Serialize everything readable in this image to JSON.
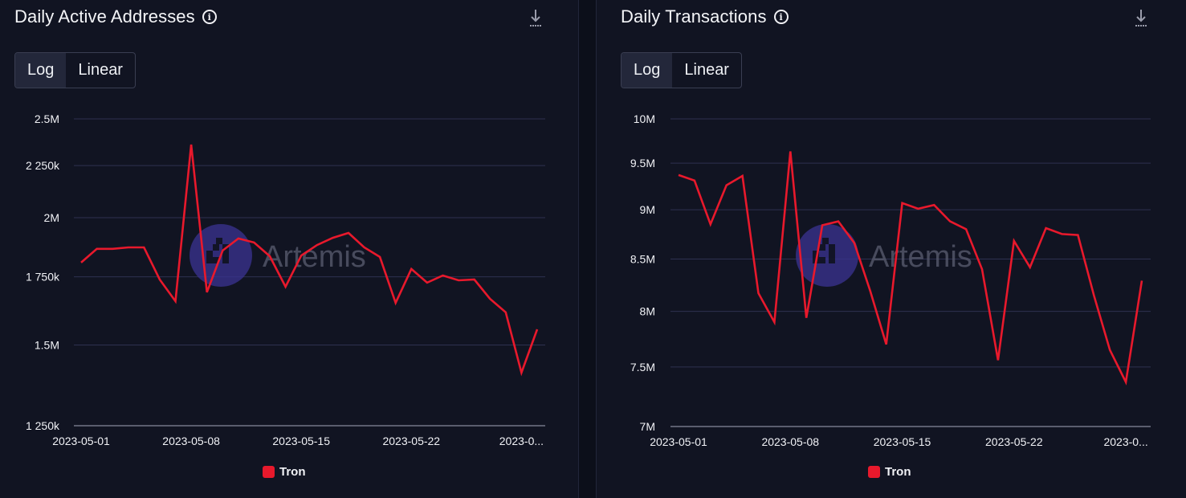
{
  "panels": [
    {
      "title": "Daily Active Addresses",
      "info_icon": "info-circle-icon",
      "download_icon": "download-icon",
      "scale_toggle": {
        "options": [
          "Log",
          "Linear"
        ],
        "selected": "Log"
      },
      "watermark": "Artemis",
      "legend": [
        {
          "label": "Tron",
          "color": "#e8192c"
        }
      ]
    },
    {
      "title": "Daily Transactions",
      "info_icon": "info-circle-icon",
      "download_icon": "download-icon",
      "scale_toggle": {
        "options": [
          "Log",
          "Linear"
        ],
        "selected": "Log"
      },
      "watermark": "Artemis",
      "legend": [
        {
          "label": "Tron",
          "color": "#e8192c"
        }
      ]
    }
  ],
  "chart_data": [
    {
      "type": "line",
      "title": "Daily Active Addresses",
      "xlabel": "",
      "ylabel": "",
      "yscale": "log",
      "ylim": [
        1250000,
        2500000
      ],
      "yticks": [
        {
          "value": 2500000,
          "label": "2.5M"
        },
        {
          "value": 2250000,
          "label": "2 250k"
        },
        {
          "value": 2000000,
          "label": "2M"
        },
        {
          "value": 1750000,
          "label": "1 750k"
        },
        {
          "value": 1500000,
          "label": "1.5M"
        },
        {
          "value": 1250000,
          "label": "1 250k"
        }
      ],
      "xticks": [
        {
          "index": 0,
          "label": "2023-05-01"
        },
        {
          "index": 7,
          "label": "2023-05-08"
        },
        {
          "index": 14,
          "label": "2023-05-15"
        },
        {
          "index": 21,
          "label": "2023-05-22"
        },
        {
          "index": 28,
          "label": "2023-0..."
        }
      ],
      "x_start": "2023-05-01",
      "x_end": "2023-05-30",
      "grid": true,
      "legend_position": "bottom",
      "series": [
        {
          "name": "Tron",
          "color": "#e8192c",
          "values": [
            1807000,
            1864000,
            1864000,
            1870000,
            1870000,
            1739000,
            1656000,
            2359000,
            1690000,
            1857000,
            1908000,
            1891000,
            1833000,
            1711000,
            1836000,
            1880000,
            1911000,
            1932000,
            1870000,
            1830000,
            1650000,
            1781000,
            1727000,
            1755000,
            1736000,
            1739000,
            1665000,
            1615000,
            1409000,
            1554000
          ]
        }
      ]
    },
    {
      "type": "line",
      "title": "Daily Transactions",
      "xlabel": "",
      "ylabel": "",
      "yscale": "log",
      "ylim": [
        7000000,
        10000000
      ],
      "yticks": [
        {
          "value": 10000000,
          "label": "10M"
        },
        {
          "value": 9500000,
          "label": "9.5M"
        },
        {
          "value": 9000000,
          "label": "9M"
        },
        {
          "value": 8500000,
          "label": "8.5M"
        },
        {
          "value": 8000000,
          "label": "8M"
        },
        {
          "value": 7500000,
          "label": "7.5M"
        },
        {
          "value": 7000000,
          "label": "7M"
        }
      ],
      "xticks": [
        {
          "index": 0,
          "label": "2023-05-01"
        },
        {
          "index": 7,
          "label": "2023-05-08"
        },
        {
          "index": 14,
          "label": "2023-05-15"
        },
        {
          "index": 21,
          "label": "2023-05-22"
        },
        {
          "index": 28,
          "label": "2023-0..."
        }
      ],
      "x_start": "2023-05-01",
      "x_end": "2023-05-30",
      "grid": true,
      "legend_position": "bottom",
      "series": [
        {
          "name": "Tron",
          "color": "#e8192c",
          "values": [
            9370000,
            9310000,
            8850000,
            9260000,
            9360000,
            8170000,
            7900000,
            9630000,
            7940000,
            8840000,
            8880000,
            8660000,
            8190000,
            7700000,
            9070000,
            9010000,
            9050000,
            8880000,
            8800000,
            8400000,
            7560000,
            8680000,
            8420000,
            8810000,
            8750000,
            8740000,
            8150000,
            7650000,
            7370000,
            8290000
          ]
        }
      ]
    }
  ]
}
